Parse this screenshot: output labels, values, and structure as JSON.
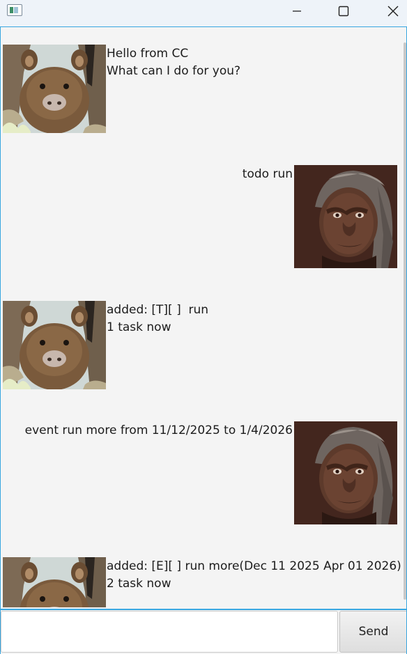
{
  "titlebar": {
    "icon": "app-window-icon",
    "buttons": [
      "minimize-icon",
      "maximize-icon",
      "close-icon"
    ]
  },
  "messages": [
    {
      "sender": "bot",
      "avatar": "wombat-avatar",
      "lines": [
        "Hello from CC",
        "What can I do for you?"
      ]
    },
    {
      "sender": "user",
      "avatar": "hominid-avatar",
      "lines": [
        "todo run"
      ]
    },
    {
      "sender": "bot",
      "avatar": "wombat-avatar",
      "lines": [
        "added: [T][ ]  run",
        "1 task now"
      ]
    },
    {
      "sender": "user",
      "avatar": "hominid-avatar",
      "lines": [
        "event run more from 11/12/2025 to 1/4/2026"
      ]
    },
    {
      "sender": "bot",
      "avatar": "wombat-avatar",
      "lines": [
        "added: [E][ ] run more(Dec 11 2025 Apr 01 2026)",
        "2 task now"
      ]
    }
  ],
  "input": {
    "value": "",
    "placeholder": ""
  },
  "send_label": "Send"
}
